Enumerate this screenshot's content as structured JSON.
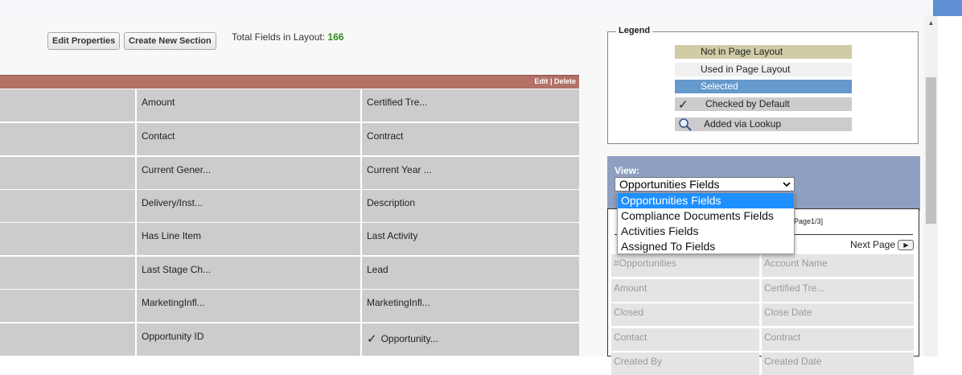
{
  "header": {
    "total_label": "Total Fields in Layout:",
    "total_count": "166"
  },
  "toolbar": {
    "edit_properties": "Edit Properties",
    "create_new_section": "Create New Section"
  },
  "section": {
    "edit_link": "Edit",
    "separator": "|",
    "delete_link": "Delete"
  },
  "layout_rows": [
    {
      "col2": "Amount",
      "col3": "Certified Tre...",
      "col3_checked": ""
    },
    {
      "col2": "Contact",
      "col3": "Contract",
      "col3_checked": ""
    },
    {
      "col2": "Current Gener...",
      "col3": "Current Year ...",
      "col3_checked": ""
    },
    {
      "col2": "Delivery/Inst...",
      "col3": "Description",
      "col3_checked": ""
    },
    {
      "col2": "Has Line Item",
      "col3": "Last Activity",
      "col3_checked": ""
    },
    {
      "col2": "Last Stage Ch...",
      "col3": "Lead",
      "col3_checked": ""
    },
    {
      "col2": "MarketingInfl...",
      "col3": "MarketingInfl...",
      "col3_checked": ""
    },
    {
      "col2": "Opportunity ID",
      "col3": "Opportunity...",
      "col3_checked": "✓"
    }
  ],
  "legend": {
    "title": "Legend",
    "not_in_layout": "Not in Page Layout",
    "used_in_layout": "Used in Page Layout",
    "selected": "Selected",
    "checked_by_default": "Checked by Default",
    "checked_icon": "✓",
    "added_via_lookup": "Added via Lookup",
    "lookup_icon": "magnifier-icon"
  },
  "view": {
    "label": "View:",
    "selected": "Opportunities Fields",
    "options": [
      "Opportunities Fields",
      "Compliance Documents Fields",
      "Activities Fields",
      "Assigned To Fields"
    ]
  },
  "fields_panel": {
    "page_indicator": "Page1/3]",
    "next_page": "Next Page",
    "rows": [
      [
        "#Opportunities",
        "Account Name"
      ],
      [
        "Amount",
        "Certified Tre..."
      ],
      [
        "Closed",
        "Close Date"
      ],
      [
        "Contact",
        "Contract"
      ],
      [
        "Created By",
        "Created Date"
      ]
    ]
  },
  "colors": {
    "section_header": "#b27266",
    "field_cell": "#cccccc",
    "not_in_layout": "#cfcca6",
    "selected": "#6699cc",
    "view_box": "#8e9fc1",
    "total_count": "#2e8b1e"
  }
}
